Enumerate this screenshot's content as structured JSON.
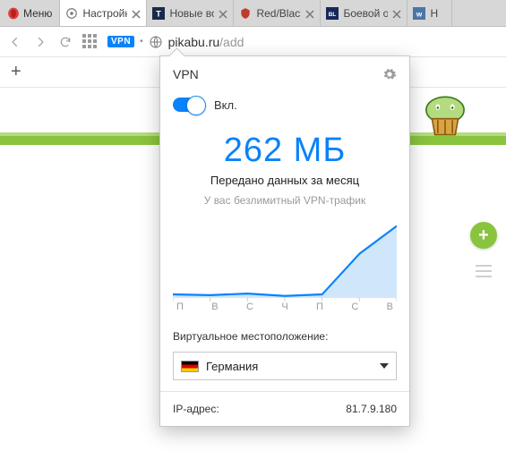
{
  "menu": {
    "label": "Меню"
  },
  "tabs": [
    {
      "label": "Настройки",
      "icon": "gear"
    },
    {
      "label": "Новые воп",
      "icon": "t-square"
    },
    {
      "label": "Red/Black T",
      "icon": "red-shield"
    },
    {
      "label": "Боевой отч",
      "icon": "bl-square"
    },
    {
      "label": "Н",
      "icon": "vk"
    }
  ],
  "newtab_plus": "+",
  "address": {
    "vpn_badge": "VPN",
    "host": "pikabu.ru",
    "path": "/add"
  },
  "side": {
    "fab_plus": "+"
  },
  "vpn": {
    "title": "VPN",
    "toggle_label": "Вкл.",
    "big_value": "262 МБ",
    "sub1": "Передано данных за месяц",
    "sub2": "У вас безлимитный VPN-трафик",
    "location_label": "Виртуальное местоположение:",
    "location_value": "Германия",
    "ip_label": "IP-адрес:",
    "ip_value": "81.7.9.180"
  },
  "chart_data": {
    "type": "area",
    "categories": [
      "П",
      "В",
      "С",
      "Ч",
      "П",
      "С",
      "В"
    ],
    "values": [
      4,
      3,
      5,
      2,
      4,
      55,
      90
    ],
    "ylim": [
      0,
      100
    ],
    "xlabel": "",
    "ylabel": "",
    "title": ""
  }
}
